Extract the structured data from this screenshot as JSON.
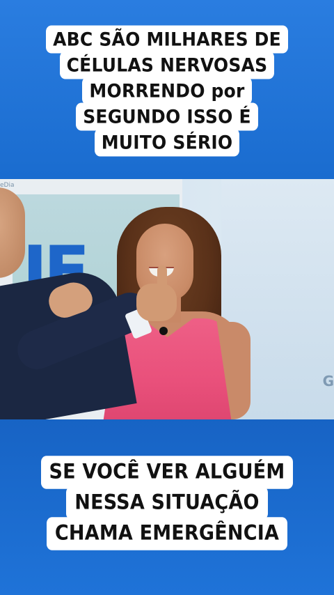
{
  "caption_top": {
    "lines": [
      "ABC SÃO MILHARES DE",
      "CÉLULAS NERVOSAS",
      "MORRENDO por",
      "SEGUNDO ISSO É",
      "MUITO SÉRIO"
    ]
  },
  "caption_bottom": {
    "lines": [
      "SE VOCÊ VER ALGUÉM",
      "NESSA SITUAÇÃO",
      "CHAMA EMERGÊNCIA"
    ]
  },
  "video": {
    "studio_logo_text": "JE",
    "corner_tag": "eDia",
    "side_mark": "G"
  },
  "colors": {
    "background": "#1f6fd0",
    "caption_bg": "#ffffff",
    "caption_text": "#111111",
    "dress": "#e9507b"
  }
}
